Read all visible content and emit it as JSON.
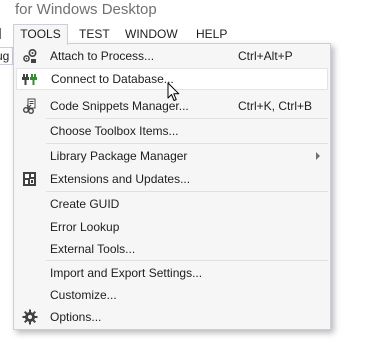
{
  "window": {
    "title_fragment": "for Windows Desktop"
  },
  "menubar": {
    "items": [
      {
        "label": "TOOLS"
      },
      {
        "label": "TEST"
      },
      {
        "label": "WINDOW"
      },
      {
        "label": "HELP"
      }
    ]
  },
  "toolbar": {
    "combo_fragment": "ug"
  },
  "tools_menu": {
    "items": [
      {
        "label": "Attach to Process...",
        "shortcut": "Ctrl+Alt+P",
        "icon": "attach-process-icon"
      },
      {
        "label": "Connect to Database...",
        "shortcut": "",
        "icon": "connect-database-icon",
        "state": "hovered"
      },
      {
        "label": "Code Snippets Manager...",
        "shortcut": "Ctrl+K, Ctrl+B",
        "icon": "code-snippets-icon"
      },
      {
        "label": "Choose Toolbox Items...",
        "shortcut": ""
      },
      {
        "label": "Library Package Manager",
        "shortcut": "",
        "submenu": true
      },
      {
        "label": "Extensions and Updates...",
        "shortcut": "",
        "icon": "extensions-icon"
      },
      {
        "label": "Create GUID",
        "shortcut": ""
      },
      {
        "label": "Error Lookup",
        "shortcut": ""
      },
      {
        "label": "External Tools...",
        "shortcut": ""
      },
      {
        "label": "Import and Export Settings...",
        "shortcut": ""
      },
      {
        "label": "Customize...",
        "shortcut": ""
      },
      {
        "label": "Options...",
        "shortcut": "",
        "icon": "gear-icon"
      }
    ]
  },
  "colors": {
    "menu_background": "#f6f6f6",
    "menu_border": "#cccedb",
    "hover_background": "#ffffff",
    "text": "#1e1e1e",
    "title_text": "#717171"
  }
}
